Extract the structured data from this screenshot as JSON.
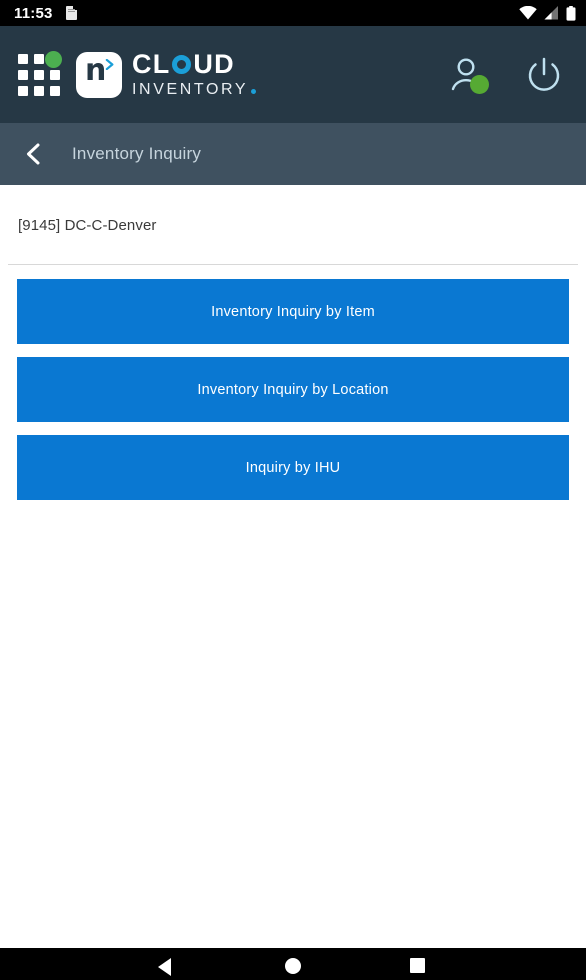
{
  "status_bar": {
    "time": "11:53",
    "icons": [
      "document-icon",
      "wifi-icon",
      "cellular-signal-icon",
      "battery-icon"
    ]
  },
  "header": {
    "app_grid_icon": "grid-menu-icon",
    "logo_letter": "n",
    "brand_line1": "CL",
    "brand_line1_end": "UD",
    "brand_line2": "INVENTORY",
    "user_icon": "user-account-icon",
    "power_icon": "power-logout-icon",
    "colors": {
      "header_bg": "#263845",
      "accent_teal": "#1b9fd8",
      "status_green": "#56aa33"
    }
  },
  "subnav": {
    "back_icon": "back-chevron-icon",
    "title": "Inventory Inquiry",
    "bg": "#3f5160"
  },
  "main": {
    "location": "[9145] DC-C-Denver",
    "buttons": [
      {
        "label": "Inventory Inquiry by Item"
      },
      {
        "label": "Inventory Inquiry by Location"
      },
      {
        "label": "Inquiry by IHU"
      }
    ],
    "button_color": "#0a78d2"
  },
  "android_nav": {
    "back": "back-triangle-icon",
    "home": "home-circle-icon",
    "recents": "recents-square-icon"
  }
}
